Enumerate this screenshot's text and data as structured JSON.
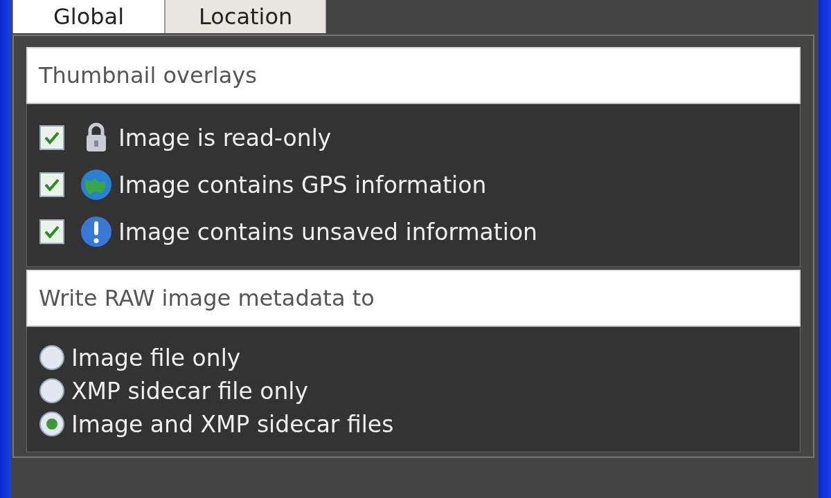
{
  "tabs": [
    {
      "label": "Global",
      "selected": true
    },
    {
      "label": "Location",
      "selected": false
    }
  ],
  "thumbnail_overlays": {
    "title": "Thumbnail overlays",
    "options": [
      {
        "label": "Image is read-only",
        "checked": true
      },
      {
        "label": "Image contains GPS information",
        "checked": true
      },
      {
        "label": "Image contains unsaved information",
        "checked": true
      }
    ]
  },
  "raw_metadata": {
    "title": "Write RAW image metadata to",
    "options": [
      {
        "label": "Image file only",
        "selected": false
      },
      {
        "label": "XMP sidecar file only",
        "selected": false
      },
      {
        "label": "Image and XMP sidecar files",
        "selected": true
      }
    ]
  }
}
